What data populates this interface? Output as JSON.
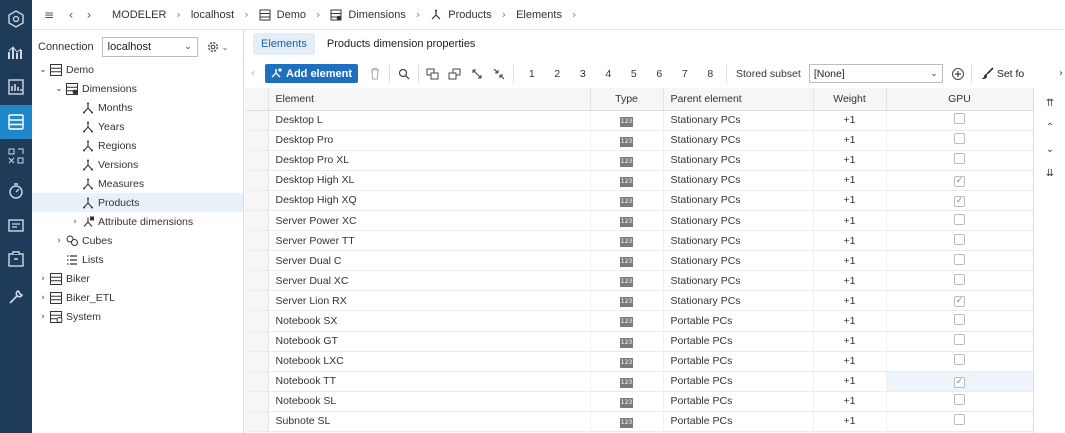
{
  "rail": {
    "items": [
      {
        "icon": "hexagon-logo-icon",
        "active": false
      },
      {
        "icon": "analytics-icon",
        "active": false
      },
      {
        "icon": "reports-icon",
        "active": false
      },
      {
        "icon": "modeler-icon",
        "active": true
      },
      {
        "icon": "integrator-icon",
        "active": false
      },
      {
        "icon": "monitor-icon",
        "active": false
      },
      {
        "icon": "cards-icon",
        "active": false
      },
      {
        "icon": "package-icon",
        "active": false
      },
      {
        "icon": "tools-icon",
        "active": false
      }
    ]
  },
  "breadcrumb": {
    "items": [
      "MODELER",
      "localhost",
      "Demo",
      "Dimensions",
      "Products",
      "Elements"
    ]
  },
  "connection": {
    "label": "Connection",
    "value": "localhost"
  },
  "tree": [
    {
      "label": "Demo",
      "caret": "open",
      "icon": "database-icon",
      "indent": 0
    },
    {
      "label": "Dimensions",
      "caret": "open",
      "icon": "dimensions-folder-icon",
      "indent": 1
    },
    {
      "label": "Months",
      "caret": "",
      "icon": "dimension-icon",
      "indent": 2
    },
    {
      "label": "Years",
      "caret": "",
      "icon": "dimension-icon",
      "indent": 2
    },
    {
      "label": "Regions",
      "caret": "",
      "icon": "dimension-icon",
      "indent": 2
    },
    {
      "label": "Versions",
      "caret": "",
      "icon": "dimension-icon",
      "indent": 2
    },
    {
      "label": "Measures",
      "caret": "",
      "icon": "dimension-icon",
      "indent": 2
    },
    {
      "label": "Products",
      "caret": "",
      "icon": "dimension-icon",
      "indent": 2,
      "selected": true
    },
    {
      "label": "Attribute dimensions",
      "caret": "closed",
      "icon": "attribute-dimension-icon",
      "indent": 2
    },
    {
      "label": "Cubes",
      "caret": "closed",
      "icon": "cubes-icon",
      "indent": 1
    },
    {
      "label": "Lists",
      "caret": "",
      "icon": "lists-icon",
      "indent": 1
    },
    {
      "label": "Biker",
      "caret": "closed",
      "icon": "database-icon",
      "indent": 0
    },
    {
      "label": "Biker_ETL",
      "caret": "closed",
      "icon": "database-icon",
      "indent": 0
    },
    {
      "label": "System",
      "caret": "closed",
      "icon": "system-database-icon",
      "indent": 0
    }
  ],
  "tabs": [
    {
      "label": "Elements",
      "active": true
    },
    {
      "label": "Products dimension properties",
      "active": false
    }
  ],
  "toolbar": {
    "add_label": "Add element",
    "levels": [
      "1",
      "2",
      "3",
      "4",
      "5",
      "6",
      "7",
      "8"
    ],
    "stored_subset_label": "Stored subset",
    "stored_subset_value": "[None]",
    "set_fo_label": "Set fo"
  },
  "grid": {
    "columns": [
      "Element",
      "Type",
      "Parent element",
      "Weight",
      "GPU"
    ],
    "type_badge": "123",
    "rows": [
      {
        "element": "Desktop L",
        "parent": "Stationary PCs",
        "weight": "+1",
        "gpu": false
      },
      {
        "element": "Desktop Pro",
        "parent": "Stationary PCs",
        "weight": "+1",
        "gpu": false
      },
      {
        "element": "Desktop Pro XL",
        "parent": "Stationary PCs",
        "weight": "+1",
        "gpu": false
      },
      {
        "element": "Desktop High XL",
        "parent": "Stationary PCs",
        "weight": "+1",
        "gpu": true
      },
      {
        "element": "Desktop High XQ",
        "parent": "Stationary PCs",
        "weight": "+1",
        "gpu": true
      },
      {
        "element": "Server Power XC",
        "parent": "Stationary PCs",
        "weight": "+1",
        "gpu": false
      },
      {
        "element": "Server Power TT",
        "parent": "Stationary PCs",
        "weight": "+1",
        "gpu": false
      },
      {
        "element": "Server Dual C",
        "parent": "Stationary PCs",
        "weight": "+1",
        "gpu": false
      },
      {
        "element": "Server Dual XC",
        "parent": "Stationary PCs",
        "weight": "+1",
        "gpu": false
      },
      {
        "element": "Server Lion RX",
        "parent": "Stationary PCs",
        "weight": "+1",
        "gpu": true
      },
      {
        "element": "Notebook SX",
        "parent": "Portable PCs",
        "weight": "+1",
        "gpu": false
      },
      {
        "element": "Notebook GT",
        "parent": "Portable PCs",
        "weight": "+1",
        "gpu": false
      },
      {
        "element": "Notebook LXC",
        "parent": "Portable PCs",
        "weight": "+1",
        "gpu": false
      },
      {
        "element": "Notebook TT",
        "parent": "Portable PCs",
        "weight": "+1",
        "gpu": true,
        "highlight": true
      },
      {
        "element": "Notebook SL",
        "parent": "Portable PCs",
        "weight": "+1",
        "gpu": false
      },
      {
        "element": "Subnote SL",
        "parent": "Portable PCs",
        "weight": "+1",
        "gpu": false
      }
    ]
  },
  "colors": {
    "rail_bg": "#1f3b5a",
    "rail_active": "#1e88c8",
    "accent": "#1f6fbf"
  }
}
